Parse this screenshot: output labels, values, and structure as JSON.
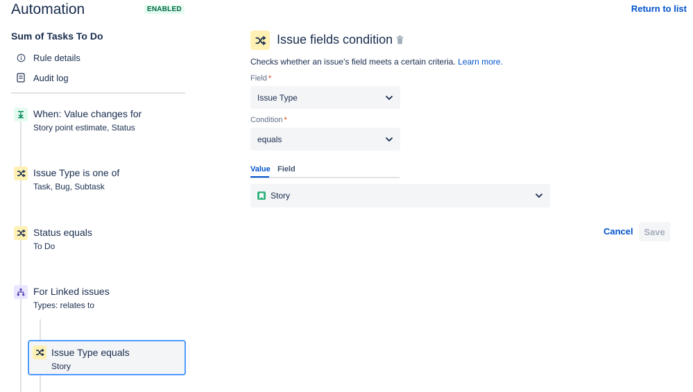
{
  "header": {
    "title": "Automation",
    "status_badge": "ENABLED",
    "return_link": "Return to list"
  },
  "sidebar": {
    "rule_name": "Sum of Tasks To Do",
    "nav": [
      {
        "label": "Rule details",
        "icon": "info-icon"
      },
      {
        "label": "Audit log",
        "icon": "audit-log-icon"
      }
    ],
    "steps": [
      {
        "title": "When: Value changes for",
        "subtitle": "Story point estimate, Status",
        "icon": "trigger-icon"
      },
      {
        "title": "Issue Type is one of",
        "subtitle": "Task, Bug, Subtask",
        "icon": "condition-shuffle-icon"
      },
      {
        "title": "Status equals",
        "subtitle": "To Do",
        "icon": "condition-shuffle-icon"
      },
      {
        "title": "For Linked issues",
        "subtitle": "Types: relates to",
        "icon": "branch-icon"
      },
      {
        "title": "Issue Type equals",
        "subtitle": "Story",
        "icon": "condition-shuffle-icon",
        "selected": true
      }
    ]
  },
  "panel": {
    "title": "Issue fields condition",
    "description": "Checks whether an issue's field meets a certain criteria.",
    "learn_more": "Learn more.",
    "field_label": "Field",
    "field_value": "Issue Type",
    "condition_label": "Condition",
    "condition_value": "equals",
    "required_marker": "*",
    "tabs": [
      {
        "label": "Value",
        "active": true
      },
      {
        "label": "Field",
        "active": false
      }
    ],
    "value_selected": "Story",
    "cancel_label": "Cancel",
    "save_label": "Save"
  },
  "colors": {
    "accent": "#0052cc",
    "condition_icon_bg": "#fff0b3",
    "trigger_icon_bg": "#e3fcef",
    "branch_icon_bg": "#eae6ff",
    "story_green": "#36b37e",
    "selected_border": "#4c9aff"
  }
}
